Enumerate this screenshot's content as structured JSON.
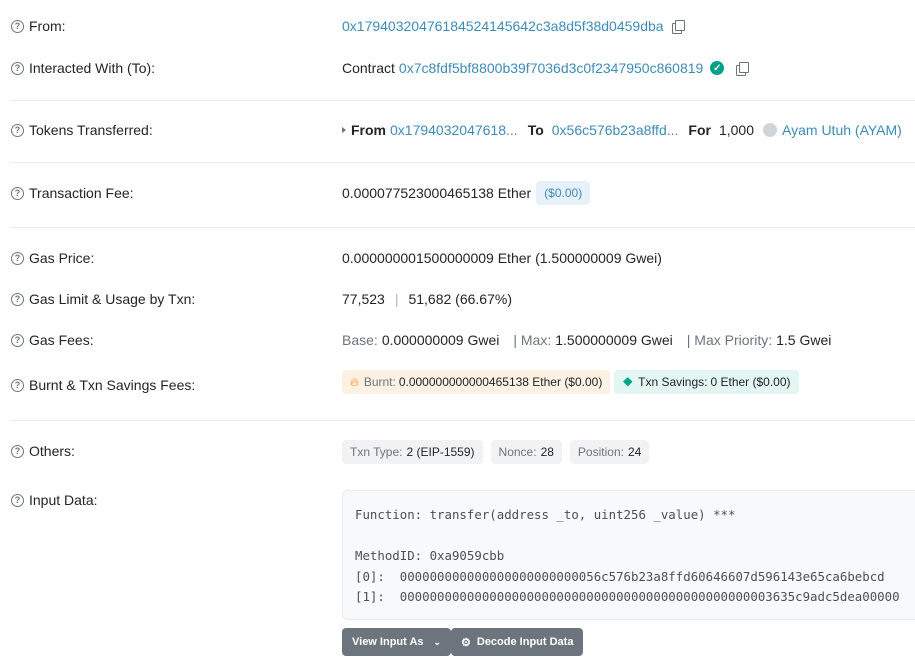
{
  "from": {
    "label": "From:",
    "address": "0x1794032047618452414 5642c3a8d5f38d0459dba"
  },
  "interacted": {
    "label": "Interacted With (To):",
    "prefix": "Contract",
    "address": "0x7c8fdf5bf8800b39f7036d3c0f2347950c860819"
  },
  "tokens": {
    "label": "Tokens Transferred:",
    "from_label": "From",
    "from_addr": "0x1794032047618...",
    "to_label": "To",
    "to_addr": "0x56c576b23a8ffd...",
    "for_label": "For",
    "amount": "1,000",
    "token_name": "Ayam Utuh (AYAM)"
  },
  "fee": {
    "label": "Transaction Fee:",
    "value": "0.000077523000465138 Ether",
    "usd": "($0.00)"
  },
  "gas_price": {
    "label": "Gas Price:",
    "value": "0.000000001500000009 Ether (1.500000009 Gwei)"
  },
  "gas_limit": {
    "label": "Gas Limit & Usage by Txn:",
    "limit": "77,523",
    "sep": "|",
    "usage": "51,682 (66.67%)"
  },
  "gas_fees": {
    "label": "Gas Fees:",
    "base_label": "Base:",
    "base": "0.000000009 Gwei",
    "max_label": "| Max:",
    "max": "1.500000009 Gwei",
    "prio_label": "| Max Priority:",
    "prio": "1.5 Gwei"
  },
  "burnt": {
    "label": "Burnt & Txn Savings Fees:",
    "burnt_label": "Burnt:",
    "burnt_value": "0.000000000000465138 Ether ($0.00)",
    "savings_label": "Txn Savings:",
    "savings_value": "0 Ether ($0.00)"
  },
  "others": {
    "label": "Others:",
    "type_label": "Txn Type:",
    "type_value": "2 (EIP-1559)",
    "nonce_label": "Nonce:",
    "nonce_value": "28",
    "pos_label": "Position:",
    "pos_value": "24"
  },
  "input": {
    "label": "Input Data:",
    "lines": [
      "Function: transfer(address _to, uint256 _value) ***",
      "",
      "MethodID: 0xa9059cbb",
      "[0]:  000000000000000000000000056c576b23a8ffd60646607d596143e65ca6bebcd",
      "[1]:  00000000000000000000000000000000000000000000000003635c9adc5dea00000"
    ]
  },
  "buttons": {
    "view_input": "View Input As",
    "decode": "Decode Input Data"
  },
  "colors": {
    "link": "#3d8bb8",
    "success": "#00a186",
    "button": "#6c757d"
  }
}
